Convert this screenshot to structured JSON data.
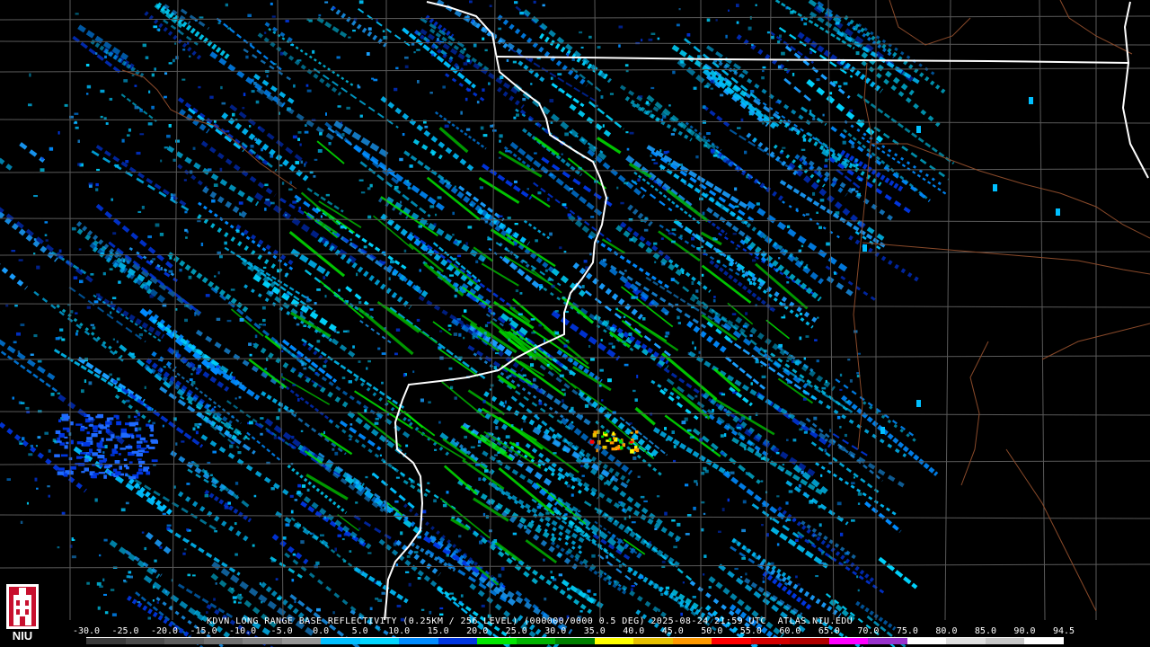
{
  "product_caption": "KDVN LONG RANGE BASE REFLECTIVITY (0.25KM / 256 LEVEL) (000000/0000 0.5 DEG) 2025-08-24 21:59 UTC  ATLAS.NIU.EDU",
  "logo_text": "NIU",
  "legend": {
    "ticks": [
      "-30.0",
      "-25.0",
      "-20.0",
      "-15.0",
      "-10.0",
      "-5.0",
      "0.0",
      "5.0",
      "10.0",
      "15.0",
      "20.0",
      "25.0",
      "30.0",
      "35.0",
      "40.0",
      "45.0",
      "50.0",
      "55.0",
      "60.0",
      "65.0",
      "70.0",
      "75.0",
      "80.0",
      "85.0",
      "90.0",
      "94.5"
    ],
    "colors": [
      "#3a3a3a",
      "#4c4c4c",
      "#5e5e5e",
      "#707070",
      "#828282",
      "#969696",
      "#00bfff",
      "#00d5ff",
      "#008bff",
      "#0036e0",
      "#00e600",
      "#00b300",
      "#008000",
      "#ffff00",
      "#e6c000",
      "#ff9900",
      "#ff0000",
      "#d40000",
      "#b00000",
      "#ff00ff",
      "#9932cc",
      "#ffffff",
      "#e0e0e0",
      "#c8c8c8",
      "#ffffff"
    ]
  },
  "colors": {
    "background": "#000000",
    "county_lines": "#5a5a5a",
    "state_lines": "#ffffff",
    "rivers": "#8a4a2a"
  }
}
